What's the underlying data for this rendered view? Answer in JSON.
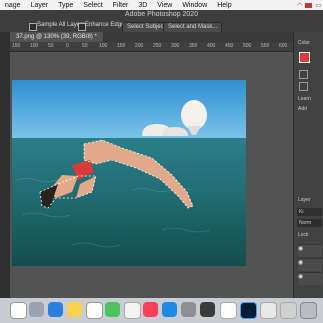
{
  "menubar": {
    "items": [
      "nage",
      "Layer",
      "Type",
      "Select",
      "Filter",
      "3D",
      "View",
      "Window",
      "Help"
    ]
  },
  "app": {
    "title": "Adobe Photoshop 2020"
  },
  "options": {
    "sample_all_layers": "Sample All Layers",
    "enhance_edge": "Enhance Edge",
    "select_subject": "Select Subject",
    "select_and_mask": "Select and Mask..."
  },
  "document": {
    "tab_label": "37.png @ 130% (39, RGB/8) *"
  },
  "ruler": {
    "ticks": [
      "150",
      "100",
      "50",
      "0",
      "50",
      "100",
      "150",
      "200",
      "250",
      "300",
      "350",
      "400",
      "450",
      "500",
      "550",
      "600"
    ]
  },
  "panels": {
    "color": "Color",
    "learn": "Learn",
    "learn_sub": "Add",
    "layers": "Layer",
    "layers_search": "Ki",
    "layers_mode": "Norm",
    "layers_lock": "Lock"
  },
  "colors": {
    "sky": "#4aa3d8",
    "sea": "#1f6f78",
    "selection": "#ffffff"
  }
}
